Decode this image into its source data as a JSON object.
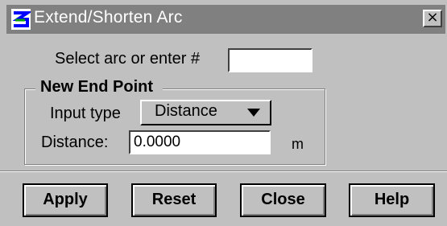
{
  "window": {
    "title": "Extend/Shorten Arc",
    "close_label": "×"
  },
  "select": {
    "label": "Select arc or enter #",
    "value": ""
  },
  "group": {
    "title": "New End Point",
    "input_type_label": "Input type",
    "input_type_value": "Distance",
    "distance_label": "Distance:",
    "distance_value": "0.0000",
    "unit": "m"
  },
  "buttons": {
    "apply": "Apply",
    "reset": "Reset",
    "close": "Close",
    "help": "Help"
  },
  "colors": {
    "face": "#c0c0c0",
    "titlebar": "#808080",
    "icon_blue": "#0000ff",
    "icon_green": "#00a000"
  },
  "icons": {
    "app": "app-icon",
    "close": "close-icon",
    "dropdown": "chevron-down-icon"
  }
}
